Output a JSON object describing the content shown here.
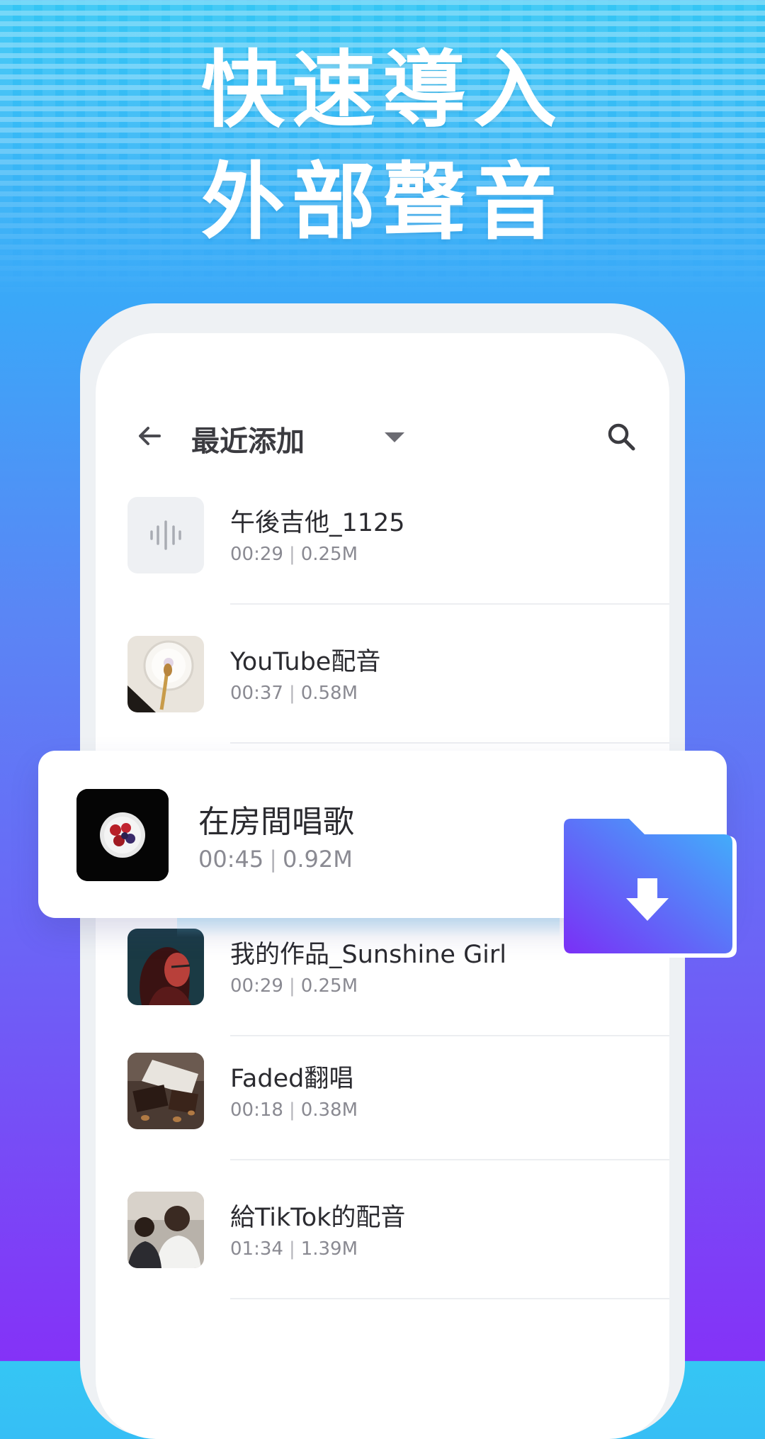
{
  "promo": {
    "headline_line1": "快速導入",
    "headline_line2": "外部聲音"
  },
  "topbar": {
    "title": "最近添加",
    "back_icon": "arrow-left-icon",
    "dropdown_icon": "caret-down-icon",
    "search_icon": "search-icon"
  },
  "list": {
    "items": [
      {
        "title": "午後吉他_1125",
        "duration": "00:29",
        "size": "0.25M",
        "thumb": "waveform-icon"
      },
      {
        "title": "YouTube配音",
        "duration": "00:37",
        "size": "0.58M",
        "thumb": "coffee-cup-photo"
      },
      {
        "title": "我的作品_Sunshine Girl",
        "duration": "00:29",
        "size": "0.25M",
        "thumb": "portrait-photo"
      },
      {
        "title": "Faded翻唱",
        "duration": "00:18",
        "size": "0.38M",
        "thumb": "brownie-photo"
      },
      {
        "title": "給TikTok的配音",
        "duration": "01:34",
        "size": "1.39M",
        "thumb": "people-photo"
      }
    ]
  },
  "highlight_card": {
    "title": "在房間唱歌",
    "duration": "00:45",
    "size": "0.92M",
    "thumb": "berries-bowl-photo"
  },
  "folder_icon": "folder-download-icon",
  "colors": {
    "accent_blue": "#3aa8f8",
    "accent_purple": "#8432f7"
  }
}
